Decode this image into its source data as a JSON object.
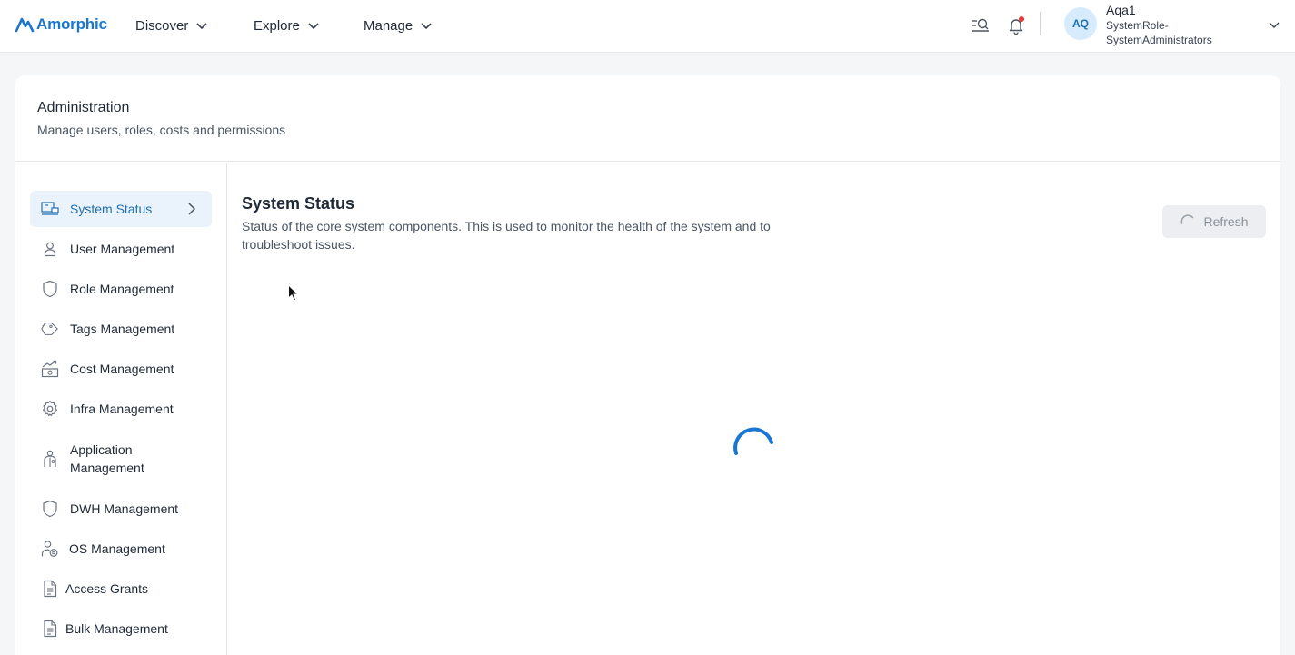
{
  "app": {
    "logo_text": "Amorphic"
  },
  "nav": {
    "items": [
      {
        "label": "Discover"
      },
      {
        "label": "Explore"
      },
      {
        "label": "Manage"
      }
    ]
  },
  "user": {
    "initials": "AQ",
    "name": "Aqa1",
    "role_line1": "SystemRole-",
    "role_line2": "SystemAdministrators"
  },
  "page": {
    "title": "Administration",
    "subtitle": "Manage users, roles, costs and permissions"
  },
  "sidebar": {
    "items": [
      {
        "label": "System Status",
        "icon": "monitor-icon",
        "active": true
      },
      {
        "label": "User Management",
        "icon": "user-icon"
      },
      {
        "label": "Role Management",
        "icon": "shield-icon"
      },
      {
        "label": "Tags Management",
        "icon": "tag-icon"
      },
      {
        "label": "Cost Management",
        "icon": "cost-chart-icon"
      },
      {
        "label": "Infra Management",
        "icon": "gear-icon"
      },
      {
        "label": "Application Management",
        "icon": "app-user-icon"
      },
      {
        "label": "DWH Management",
        "icon": "shield-icon"
      },
      {
        "label": "OS Management",
        "icon": "user-gear-icon"
      },
      {
        "label": "Access Grants",
        "icon": "document-icon"
      },
      {
        "label": "Bulk Management",
        "icon": "document-icon"
      }
    ]
  },
  "content": {
    "title": "System Status",
    "description": "Status of the core system components. This is used to monitor the health of the system and to troubleshoot issues.",
    "refresh_label": "Refresh",
    "loading": true
  },
  "colors": {
    "accent": "#1976d2",
    "active_bg": "#eaf3fb",
    "notification_dot": "#e53935"
  }
}
